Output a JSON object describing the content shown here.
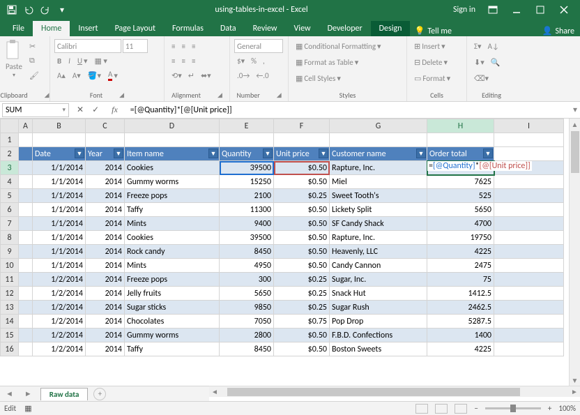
{
  "app": {
    "title": "using-tables-in-excel - Excel",
    "signin": "Sign in"
  },
  "tabs": [
    "File",
    "Home",
    "Insert",
    "Page Layout",
    "Formulas",
    "Data",
    "Review",
    "View",
    "Developer",
    "Design"
  ],
  "active_tab": "Home",
  "tell_me": "Tell me",
  "share": "Share",
  "ribbon": {
    "clipboard": {
      "label": "Clipboard",
      "paste": "Paste"
    },
    "font": {
      "label": "Font",
      "name": "Calibri",
      "size": "11"
    },
    "alignment": {
      "label": "Alignment"
    },
    "number": {
      "label": "Number",
      "format": "General"
    },
    "styles": {
      "label": "Styles",
      "cond": "Conditional Formatting",
      "table": "Format as Table",
      "cell": "Cell Styles"
    },
    "cells": {
      "label": "Cells",
      "insert": "Insert",
      "delete": "Delete",
      "format": "Format"
    },
    "editing": {
      "label": "Editing"
    }
  },
  "namebox": "SUM",
  "formula": "=[@Quantity]*[@[Unit price]]",
  "columns": [
    "",
    "A",
    "B",
    "C",
    "D",
    "E",
    "F",
    "G",
    "H",
    "I"
  ],
  "active_col": "H",
  "active_row": "3",
  "headers": [
    "Date",
    "Year",
    "Item name",
    "Quantity",
    "Unit price",
    "Customer name",
    "Order total"
  ],
  "formula_tokens": {
    "eq": "=",
    "q": "[@Quantity]",
    "star": "*",
    "u": "[@[Unit price]]"
  },
  "rows": [
    {
      "n": 3,
      "date": "1/1/2014",
      "year": "2014",
      "item": "Cookies",
      "qty": "39500",
      "price": "$0.50",
      "cust": "Rapture, Inc.",
      "total": "__FORMULA__",
      "band": false
    },
    {
      "n": 4,
      "date": "1/1/2014",
      "year": "2014",
      "item": "Gummy worms",
      "qty": "15250",
      "price": "$0.50",
      "cust": "Miel",
      "total": "7625",
      "band": true
    },
    {
      "n": 5,
      "date": "1/1/2014",
      "year": "2014",
      "item": "Freeze pops",
      "qty": "2100",
      "price": "$0.25",
      "cust": "Sweet Tooth's",
      "total": "525",
      "band": false
    },
    {
      "n": 6,
      "date": "1/1/2014",
      "year": "2014",
      "item": "Taffy",
      "qty": "11300",
      "price": "$0.50",
      "cust": "Lickety Split",
      "total": "5650",
      "band": true
    },
    {
      "n": 7,
      "date": "1/1/2014",
      "year": "2014",
      "item": "Mints",
      "qty": "9400",
      "price": "$0.50",
      "cust": "SF Candy Shack",
      "total": "4700",
      "band": false
    },
    {
      "n": 8,
      "date": "1/1/2014",
      "year": "2014",
      "item": "Cookies",
      "qty": "39500",
      "price": "$0.50",
      "cust": "Rapture, Inc.",
      "total": "19750",
      "band": true
    },
    {
      "n": 9,
      "date": "1/1/2014",
      "year": "2014",
      "item": "Rock candy",
      "qty": "8450",
      "price": "$0.50",
      "cust": "Heavenly, LLC",
      "total": "4225",
      "band": false
    },
    {
      "n": 10,
      "date": "1/1/2014",
      "year": "2014",
      "item": "Mints",
      "qty": "4950",
      "price": "$0.50",
      "cust": "Candy Cannon",
      "total": "2475",
      "band": true
    },
    {
      "n": 11,
      "date": "1/2/2014",
      "year": "2014",
      "item": "Freeze pops",
      "qty": "300",
      "price": "$0.25",
      "cust": "Sugar, Inc.",
      "total": "75",
      "band": false
    },
    {
      "n": 12,
      "date": "1/2/2014",
      "year": "2014",
      "item": "Jelly fruits",
      "qty": "5650",
      "price": "$0.25",
      "cust": "Snack Hut",
      "total": "1412.5",
      "band": true
    },
    {
      "n": 13,
      "date": "1/2/2014",
      "year": "2014",
      "item": "Sugar sticks",
      "qty": "9850",
      "price": "$0.25",
      "cust": "Sugar Rush",
      "total": "2462.5",
      "band": false
    },
    {
      "n": 14,
      "date": "1/2/2014",
      "year": "2014",
      "item": "Chocolates",
      "qty": "7050",
      "price": "$0.75",
      "cust": "Pop Drop",
      "total": "5287.5",
      "band": true
    },
    {
      "n": 15,
      "date": "1/2/2014",
      "year": "2014",
      "item": "Gummy worms",
      "qty": "2800",
      "price": "$0.50",
      "cust": "F.B.D. Confections",
      "total": "1400",
      "band": false
    },
    {
      "n": 16,
      "date": "1/2/2014",
      "year": "2014",
      "item": "Taffy",
      "qty": "8450",
      "price": "$0.50",
      "cust": "Boston Sweets",
      "total": "4225",
      "band": true
    }
  ],
  "sheet_tab": "Raw data",
  "status": {
    "mode": "Edit",
    "zoom": "100%"
  }
}
